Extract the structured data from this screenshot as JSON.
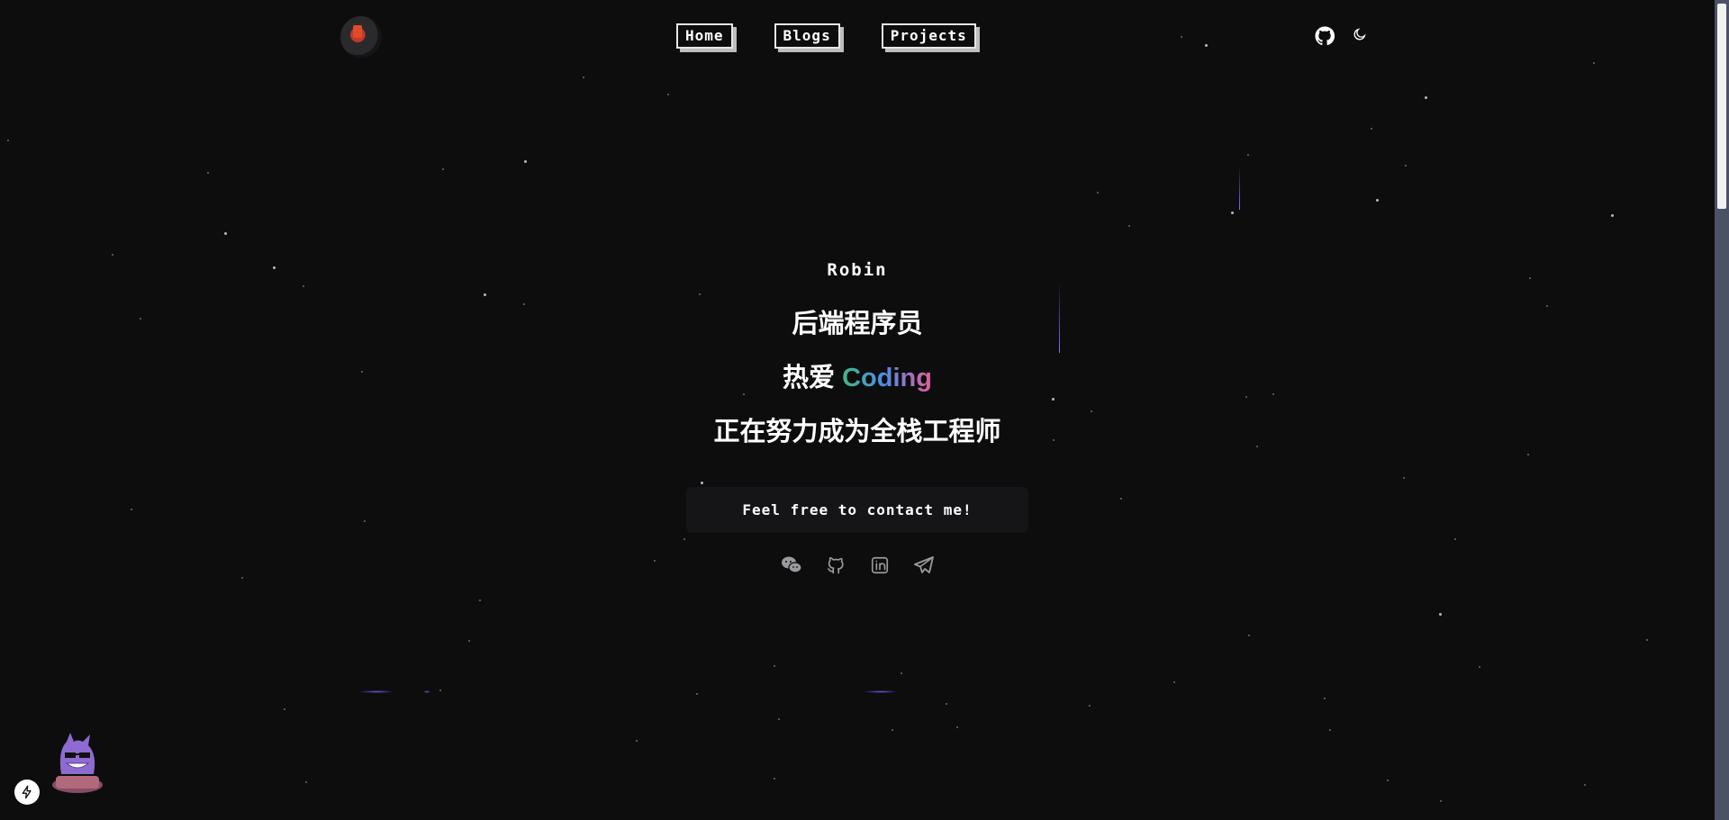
{
  "header": {
    "logo": {
      "icon": "avatar-logo"
    },
    "nav": [
      {
        "label": "Home"
      },
      {
        "label": "Blogs"
      },
      {
        "label": "Projects"
      }
    ],
    "icons": [
      "github-icon",
      "moon-icon"
    ]
  },
  "hero": {
    "name": "Robin",
    "line1": "后端程序员",
    "line2_prefix": "热爱 ",
    "line2_highlight": "Coding",
    "line3": "正在努力成为全栈工程师",
    "contact": "Feel free to contact me!",
    "socials": [
      "wechat-icon",
      "github-icon",
      "linkedin-icon",
      "telegram-icon"
    ]
  },
  "colors": {
    "background": "#0d0d0e",
    "text": "#ffffff",
    "gradient": [
      "#41b883",
      "#4b8ee8",
      "#e35d9a"
    ],
    "meteor": "#8b6cff",
    "scrollbar_track": "#4b5265"
  }
}
